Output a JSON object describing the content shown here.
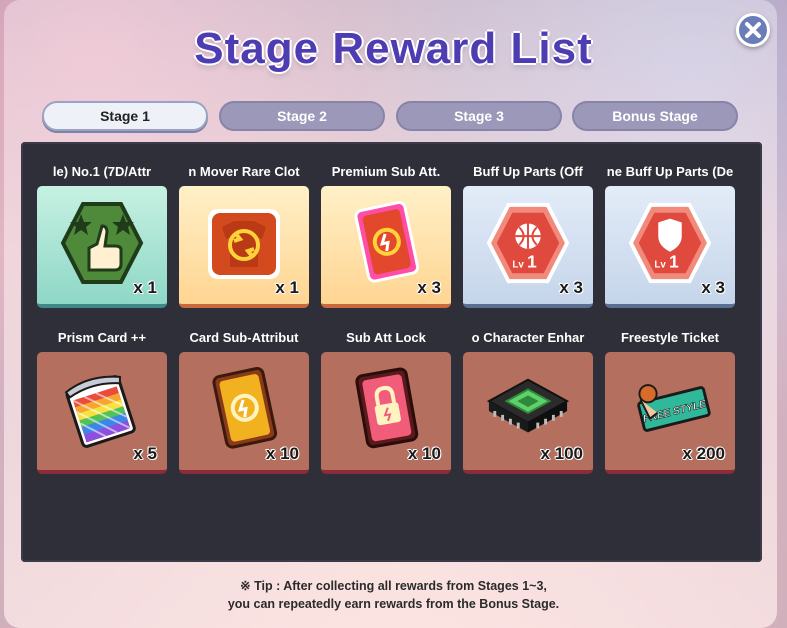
{
  "title": "Stage Reward List",
  "tabs": [
    {
      "label": "Stage 1",
      "active": true
    },
    {
      "label": "Stage 2",
      "active": false
    },
    {
      "label": "Stage 3",
      "active": false
    },
    {
      "label": "Bonus Stage",
      "active": false
    }
  ],
  "rewards": [
    {
      "name": "le)   No.1 (7D/Attr",
      "qty": "x 1",
      "icon": "thumbs-up-hexagon-icon",
      "style": "teal"
    },
    {
      "name": "n Mover   Rare Clot",
      "qty": "x 1",
      "icon": "outfit-swap-icon",
      "style": "gold"
    },
    {
      "name": "Premium Sub Att.",
      "qty": "x 3",
      "icon": "premium-sub-att-card-icon",
      "style": "gold"
    },
    {
      "name": "Buff Up Parts (Off",
      "qty": "x 3",
      "icon": "basketball-buff-parts-icon",
      "style": "blue"
    },
    {
      "name": "ne Buff Up Parts (De",
      "qty": "x 3",
      "icon": "shield-buff-parts-icon",
      "style": "blue"
    },
    {
      "name": "Prism Card ++",
      "qty": "x 5",
      "icon": "prism-card-icon",
      "style": "brown"
    },
    {
      "name": "Card Sub-Attribut",
      "qty": "x 10",
      "icon": "sub-attribute-card-icon",
      "style": "brown"
    },
    {
      "name": "Sub Att Lock",
      "qty": "x 10",
      "icon": "sub-att-lock-icon",
      "style": "brown"
    },
    {
      "name": "o   Character Enhar",
      "qty": "x 100",
      "icon": "chip-icon",
      "style": "brown"
    },
    {
      "name": "Freestyle Ticket",
      "qty": "x 200",
      "icon": "freestyle-ticket-icon",
      "style": "brown"
    }
  ],
  "lv_label": "Lv",
  "lv_number": "1",
  "ticket_text": "FREE STYLE",
  "tip": {
    "line1": "※ Tip : After collecting all rewards from Stages 1~3,",
    "line2": "you can repeatedly earn rewards from the Bonus Stage."
  }
}
